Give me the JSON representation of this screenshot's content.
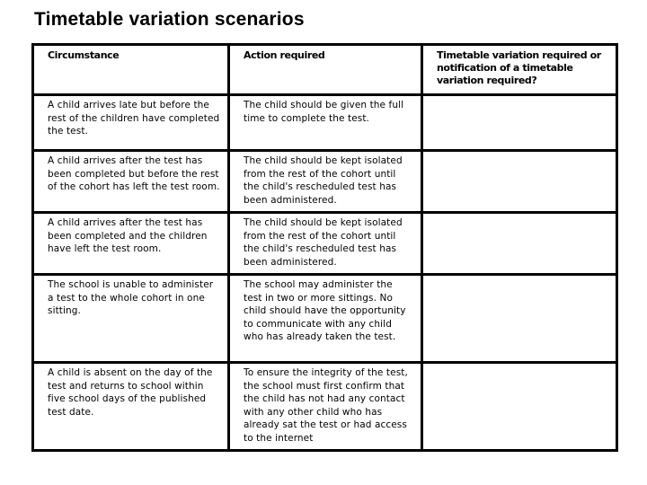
{
  "title": "Timetable variation scenarios",
  "table": {
    "headers": [
      "Circumstance",
      "Action required",
      "Timetable variation required or notification of a timetable variation required?"
    ],
    "rows": [
      {
        "circumstance": "A child arrives late but before the rest of the children have completed the test.",
        "action": "The child should be given the full time to complete the test.",
        "variation": ""
      },
      {
        "circumstance": "A child arrives after the test has been completed but before the rest of the cohort has left the test room.",
        "action": "The child should be kept isolated from the rest of the cohort until the child's rescheduled test has been administered.",
        "variation": ""
      },
      {
        "circumstance": "A child arrives after the test has been completed and the children have left the test room.",
        "action": "The child should be kept isolated from the rest of the cohort until the child's rescheduled test has been administered.",
        "variation": ""
      },
      {
        "circumstance": "The school is unable to administer a test to the whole cohort in one sitting.",
        "action": "The school may administer the test in two or more sittings.  No child should have the opportunity to communicate with any child who has already taken the test.",
        "variation": ""
      },
      {
        "circumstance": "A child is absent on the day of the test and returns to school within five school days of the published test date.",
        "action": "To ensure the integrity of the test, the school must first confirm that the child has not had any contact with any other child who has already sat the test or had access to the internet",
        "variation": ""
      }
    ]
  }
}
